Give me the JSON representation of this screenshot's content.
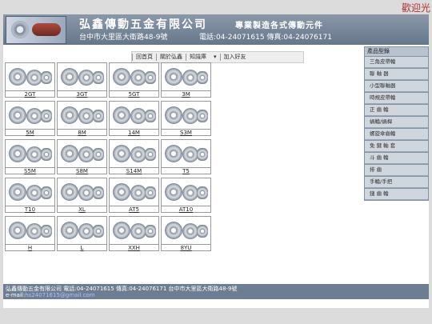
{
  "welcome": "歡迎光",
  "header": {
    "company": "弘鑫傳動五金有限公司",
    "slogan": "專業製造各式傳動元件",
    "address": "台中市大里區大衛路48-9號",
    "tel": "電話:04-24071615 傳真:04-24076171"
  },
  "topnav": {
    "items": [
      "回首頁",
      "關於弘鑫",
      "知識庫",
      "加入好友"
    ]
  },
  "products": [
    {
      "name": "2GT"
    },
    {
      "name": "3GT"
    },
    {
      "name": "5GT"
    },
    {
      "name": "3M"
    },
    {
      "name": "5M"
    },
    {
      "name": "8M"
    },
    {
      "name": "14M"
    },
    {
      "name": "S3M"
    },
    {
      "name": "S5M"
    },
    {
      "name": "S8M"
    },
    {
      "name": "S14M"
    },
    {
      "name": "T5"
    },
    {
      "name": "T10"
    },
    {
      "name": "XL"
    },
    {
      "name": "AT5"
    },
    {
      "name": "AT10"
    },
    {
      "name": "H"
    },
    {
      "name": "L"
    },
    {
      "name": "XXH"
    },
    {
      "name": "8YU"
    }
  ],
  "sidebar": {
    "title": "產品型錄",
    "items": [
      "三角皮帶輪",
      "聯 軸 器",
      "小型聯軸器",
      "時規皮帶輪",
      "正 齒 輪",
      "蝸輪/蝸桿",
      "螺旋傘齒輪",
      "免 鍵 軸 套",
      "斗 齒 輪",
      "排 齒",
      "手輪/手把",
      "鏈 齒 輪"
    ]
  },
  "footer": {
    "line1": "弘鑫傳動五金有限公司 電話:04-24071615 傳真:04-24076171 台中市大里區大衛路48-9號",
    "email_label": "e-mail:",
    "email": "hs24071615@gmail.com"
  }
}
